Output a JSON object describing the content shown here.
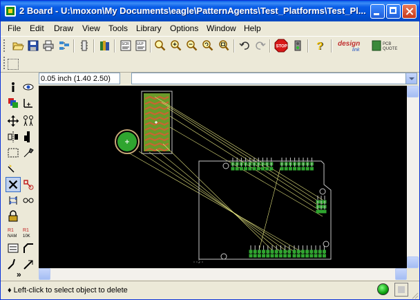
{
  "window": {
    "title": "2 Board - U:\\moxon\\My Documents\\eagle\\PatternAgents\\Test_Platforms\\Test_Pl..."
  },
  "menu": [
    "File",
    "Edit",
    "Draw",
    "View",
    "Tools",
    "Library",
    "Options",
    "Window",
    "Help"
  ],
  "toolbar": {
    "icons": [
      "open-icon",
      "save-icon",
      "print-icon",
      "cam-icon",
      "board-switch-icon",
      "library-icon",
      "script-icon",
      "run-ulp-icon",
      "zoom-fit-icon",
      "zoom-in-icon",
      "zoom-out-icon",
      "zoom-redraw-icon",
      "zoom-select-icon",
      "undo-icon",
      "redo-icon",
      "stop-icon",
      "go-icon",
      "help-icon"
    ],
    "designlink_label": "design",
    "designlink_sub": "link",
    "pcbquote_label": "PCB",
    "pcbquote_sub": "QUOTE",
    "stop_text": "STOP"
  },
  "coordinates": "0.05 inch (1.40 2.50)",
  "command_input": {
    "value": ""
  },
  "palette": {
    "tools": [
      "info-icon",
      "show-icon",
      "display-icon",
      "mark-icon",
      "move-icon",
      "copy-icon",
      "mirror-icon",
      "rotate-icon",
      "group-icon",
      "change-icon",
      "paste-icon",
      "delete-icon",
      "add-icon",
      "pinswap-icon",
      "replace-icon",
      "lock-icon",
      "name-icon",
      "value-icon",
      "smash-icon",
      "miter-icon",
      "split-icon",
      "optimize-icon",
      "more-icon"
    ],
    "selected": "delete-icon",
    "more_glyph": "»"
  },
  "board": {
    "colors": {
      "background": "#000000",
      "outline": "#c8c8c8",
      "airwire": "#e6e680",
      "pad": "#2fa52f",
      "pad_ring": "#c8c8c8",
      "trace": "#c86432"
    }
  },
  "status": {
    "text": "Left-click to select object to delete",
    "light": "ready"
  }
}
